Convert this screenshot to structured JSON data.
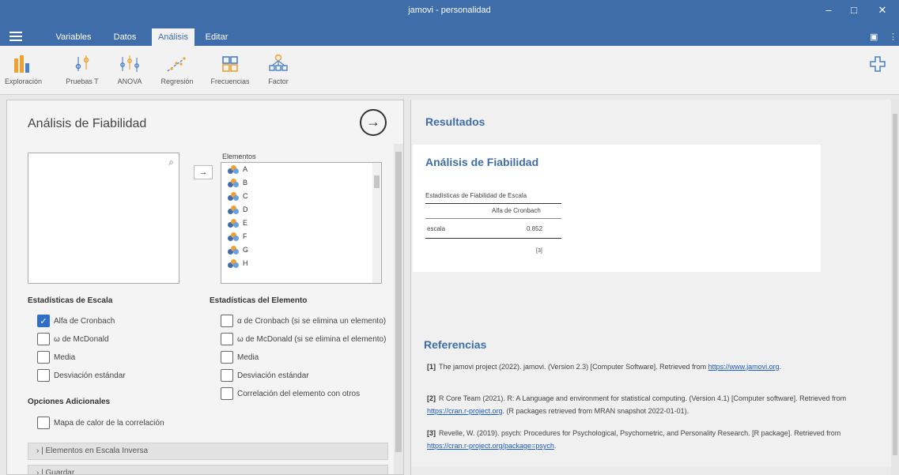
{
  "window": {
    "title": "jamovi - personalidad",
    "controls": [
      "–",
      "□",
      "✕"
    ]
  },
  "menu": {
    "tabs": [
      {
        "label": "Variables",
        "active": false
      },
      {
        "label": "Datos",
        "active": false
      },
      {
        "label": "Análisis",
        "active": true
      },
      {
        "label": "Editar",
        "active": false
      }
    ]
  },
  "ribbon": {
    "buttons": [
      {
        "label": "Exploración",
        "icon": "bar-chart-icon"
      },
      {
        "label": "Pruebas T",
        "icon": "t-tests-icon"
      },
      {
        "label": "ANOVA",
        "icon": "anova-icon"
      },
      {
        "label": "Regresión",
        "icon": "regression-icon"
      },
      {
        "label": "Frecuencias",
        "icon": "frequencies-icon"
      },
      {
        "label": "Factor",
        "icon": "factor-icon"
      }
    ],
    "modules_label": "Módulos"
  },
  "analysis": {
    "title": "Análisis de Fiabilidad",
    "elements_label": "Elementos",
    "elements": [
      "A",
      "B",
      "C",
      "D",
      "E",
      "F",
      "G",
      "H"
    ],
    "scale_stats": {
      "heading": "Estadísticas de Escala",
      "options": [
        {
          "label": "Alfa de Cronbach",
          "checked": true
        },
        {
          "label": "ω de McDonald",
          "checked": false
        },
        {
          "label": "Media",
          "checked": false
        },
        {
          "label": "Desviación estándar",
          "checked": false
        }
      ]
    },
    "item_stats": {
      "heading": "Estadísticas del Elemento",
      "options": [
        {
          "label": "α de Cronbach (si se elimina un elemento)",
          "checked": false
        },
        {
          "label": "ω de McDonald (si se elimina el elemento)",
          "checked": false
        },
        {
          "label": "Media",
          "checked": false
        },
        {
          "label": "Desviación estándar",
          "checked": false
        },
        {
          "label": "Correlación del elemento con otros",
          "checked": false
        }
      ]
    },
    "additional": {
      "heading": "Opciones Adicionales",
      "options": [
        {
          "label": "Mapa de calor de la correlación",
          "checked": false
        }
      ]
    },
    "collapsers": [
      "Elementos en Escala Inversa",
      "Guardar"
    ]
  },
  "results": {
    "title": "Resultados",
    "card_title": "Análisis de Fiabilidad",
    "table": {
      "title": "Estadísticas de Fiabilidad de Escala",
      "column": "Alfa de Cronbach",
      "row_label": "escala",
      "value": "0.852",
      "footnote": "[3]"
    },
    "references_title": "Referencias",
    "references": [
      {
        "num": "[1]",
        "text": "The jamovi project (2022). jamovi. (Version 2.3) [Computer Software]. Retrieved from ",
        "link": "https://www.jamovi.org",
        "after": "."
      },
      {
        "num": "[2]",
        "text": "R Core Team (2021). R: A Language and environment for statistical computing. (Version 4.1) [Computer software]. Retrieved from ",
        "link": "https://cran.r-project.org",
        "after": ". (R packages retrieved from MRAN snapshot 2022-01-01)."
      },
      {
        "num": "[3]",
        "text": "Revelle, W. (2019). psych: Procedures for Psychological, Psychometric, and Personality Research. [R package]. Retrieved from ",
        "link": "https://cran.r-project.org/package=psych",
        "after": "."
      }
    ]
  },
  "colors": {
    "accent": "#3e6da9",
    "check": "#2f6fc8",
    "link": "#1a5bbf"
  }
}
